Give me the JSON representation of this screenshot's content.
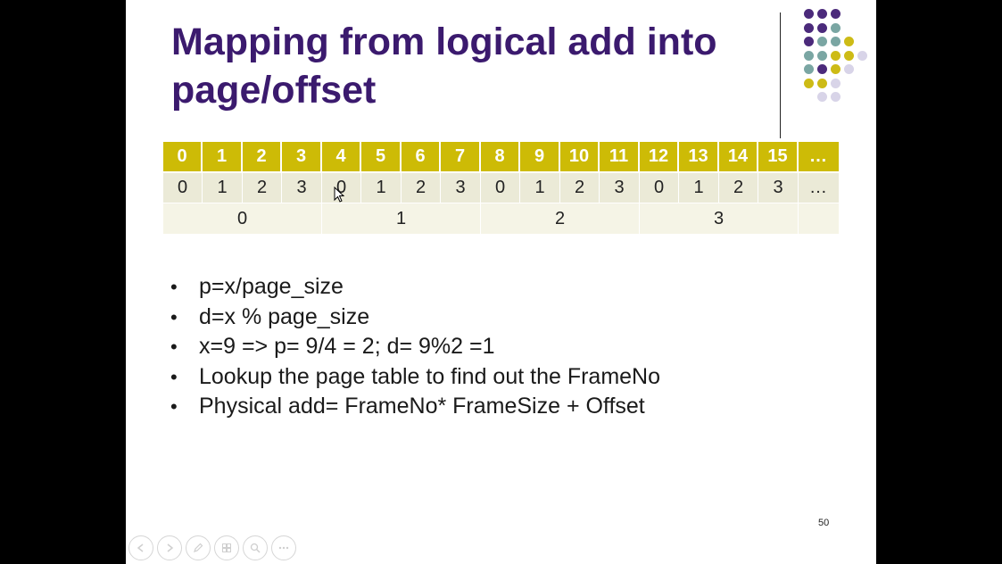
{
  "slide": {
    "title": "Mapping from logical add into page/offset",
    "page_number": "50",
    "colors": {
      "title": "#3b1a6e",
      "header_band": "#cdbb06",
      "offset_band": "#ebead7",
      "page_band": "#f5f4e6",
      "dot_purple": "#4b2a7b",
      "dot_teal": "#7aa6a3",
      "dot_olive": "#cdbb16",
      "dot_lilac": "#d8d4e8"
    }
  },
  "table": {
    "logical_addresses": [
      "0",
      "1",
      "2",
      "3",
      "4",
      "5",
      "6",
      "7",
      "8",
      "9",
      "10",
      "11",
      "12",
      "13",
      "14",
      "15",
      "…"
    ],
    "offsets": [
      "0",
      "1",
      "2",
      "3",
      "0",
      "1",
      "2",
      "3",
      "0",
      "1",
      "2",
      "3",
      "0",
      "1",
      "2",
      "3",
      "…"
    ],
    "pages": [
      "0",
      "1",
      "2",
      "3",
      ""
    ]
  },
  "bullets": [
    "p=x/page_size",
    "d=x % page_size",
    "x=9 => p= 9/4 = 2; d= 9%2 =1",
    "Lookup the page table to find out the FrameNo",
    "Physical add= FrameNo* FrameSize + Offset"
  ],
  "toolbar": {
    "icons": [
      "previous-slide-icon",
      "next-slide-icon",
      "pen-icon",
      "slides-grid-icon",
      "zoom-icon",
      "more-options-icon"
    ]
  }
}
